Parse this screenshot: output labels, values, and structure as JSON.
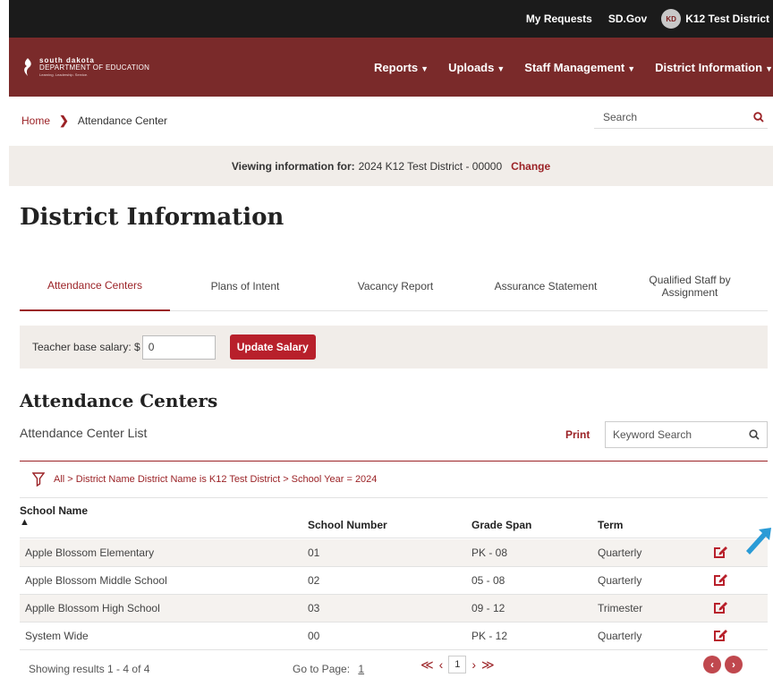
{
  "topbar": {
    "my_requests": "My Requests",
    "sd_gov": "SD.Gov",
    "avatar_initials": "KD",
    "user_name": "K12 Test District"
  },
  "logo": {
    "line1": "south dakota",
    "line2": "DEPARTMENT OF EDUCATION",
    "tagline": "Learning. Leadership. Service."
  },
  "nav": {
    "items": [
      "Reports",
      "Uploads",
      "Staff Management",
      "District Information"
    ]
  },
  "breadcrumb": {
    "home": "Home",
    "current": "Attendance Center"
  },
  "search": {
    "placeholder": "Search"
  },
  "viewing": {
    "label": "Viewing information for:",
    "value": "2024 K12 Test District - 00000",
    "change": "Change"
  },
  "page_title": "District Information",
  "tabs": [
    "Attendance Centers",
    "Plans of Intent",
    "Vacancy Report",
    "Assurance Statement",
    "Qualified Staff by Assignment"
  ],
  "salary": {
    "label": "Teacher base salary: $",
    "value": "0",
    "button": "Update Salary"
  },
  "section_title": "Attendance Centers",
  "list": {
    "title": "Attendance Center List",
    "print": "Print",
    "keyword_placeholder": "Keyword Search",
    "filter": "All > District Name District Name is K12 Test District > School Year = 2024",
    "columns": [
      "School Name",
      "School Number",
      "Grade Span",
      "Term"
    ],
    "rows": [
      [
        "Apple Blossom Elementary",
        "01",
        "PK - 08",
        "Quarterly"
      ],
      [
        "Apple Blossom Middle School",
        "02",
        "05 - 08",
        "Quarterly"
      ],
      [
        "Applle Blossom High School",
        "03",
        "09 - 12",
        "Trimester"
      ],
      [
        "System Wide",
        "00",
        "PK - 12",
        "Quarterly"
      ]
    ]
  },
  "footer": {
    "showing": "Showing results 1 - 4 of 4",
    "goto_label": "Go to Page:",
    "goto_value": "1",
    "current_page": "1"
  },
  "colors": {
    "brand": "#7a2a2a",
    "accent": "#9b2226",
    "button": "#b8202b",
    "pointer": "#2a9bd6"
  }
}
